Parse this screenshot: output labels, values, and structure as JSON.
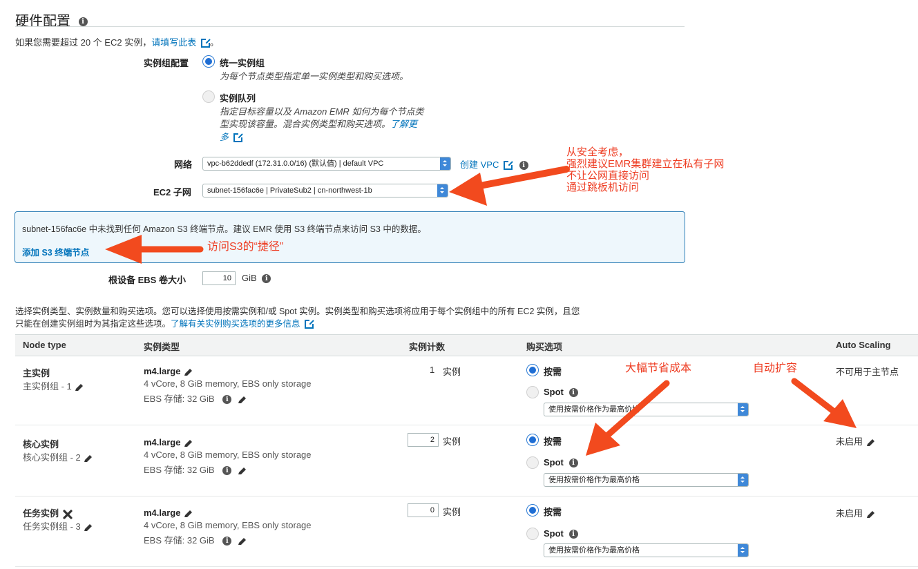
{
  "header": {
    "title": "硬件配置",
    "limit_text": "如果您需要超过 20 个 EC2 实例，",
    "limit_link": "请填写此表",
    "limit_suffix": "。"
  },
  "instance_group_config": {
    "label": "实例组配置",
    "options": [
      {
        "title": "统一实例组",
        "desc": "为每个节点类型指定单一实例类型和购买选项。",
        "selected": true
      },
      {
        "title": "实例队列",
        "desc_lines": [
          "指定目标容量以及 Amazon EMR 如何为每个节点类",
          "型实现该容量。混合实例类型和购买选项。"
        ],
        "learn_more": "了解更",
        "learn_more_2": "多",
        "selected": false
      }
    ]
  },
  "network": {
    "label": "网络",
    "value": "vpc-b62ddedf (172.31.0.0/16) (默认值) | default VPC",
    "create_link": "创建 VPC"
  },
  "subnet": {
    "label": "EC2 子网",
    "value": "subnet-156fac6e | PrivateSub2 | cn-northwest-1b"
  },
  "notice": {
    "text": "subnet-156fac6e 中未找到任何 Amazon S3 终端节点。建议 EMR 使用 S3 终端节点来访问 S3 中的数据。",
    "link": "添加 S3 终端节点"
  },
  "root_ebs": {
    "label": "根设备 EBS 卷大小",
    "value": "10",
    "unit": "GiB"
  },
  "description": {
    "line1": "选择实例类型、实例数量和购买选项。您可以选择使用按需实例和/或 Spot 实例。实例类型和购买选项将应用于每个实例组中的所有 EC2 实例，且您",
    "line2": "只能在创建实例组时为其指定这些选项。",
    "link": "了解有关实例购买选项的更多信息"
  },
  "table": {
    "headers": [
      "Node type",
      "实例类型",
      "实例计数",
      "购买选项",
      "Auto Scaling"
    ],
    "rows": [
      {
        "node": "主实例",
        "group": "主实例组 - 1",
        "type": "m4.large",
        "specs": "4 vCore, 8 GiB memory, EBS only storage",
        "ebs": "EBS 存储:  32 GiB",
        "count": "1",
        "count_unit": "实例",
        "count_editable": false,
        "on_demand": "按需",
        "spot": "Spot",
        "price": "使用按需价格作为最高价格",
        "autoscaling": "不可用于主节点",
        "removable": false
      },
      {
        "node": "核心实例",
        "group": "核心实例组 - 2",
        "type": "m4.large",
        "specs": "4 vCore, 8 GiB memory, EBS only storage",
        "ebs": "EBS 存储:  32 GiB",
        "count": "2",
        "count_unit": "实例",
        "count_editable": true,
        "on_demand": "按需",
        "spot": "Spot",
        "price": "使用按需价格作为最高价格",
        "autoscaling": "未启用",
        "removable": false
      },
      {
        "node": "任务实例",
        "group": "任务实例组 - 3",
        "type": "m4.large",
        "specs": "4 vCore, 8 GiB memory, EBS only storage",
        "ebs": "EBS 存储:  32 GiB",
        "count": "0",
        "count_unit": "实例",
        "count_editable": true,
        "on_demand": "按需",
        "spot": "Spot",
        "price": "使用按需价格作为最高价格",
        "autoscaling": "未启用",
        "removable": true
      }
    ]
  },
  "annotations": {
    "security": [
      "从安全考虑，",
      "强烈建议EMR集群建立在私有子网",
      "不让公网直接访问",
      "通过跳板机访问"
    ],
    "s3_shortcut": "访问S3的“捷径”",
    "save_cost": "大幅节省成本",
    "auto_scale": "自动扩容",
    "color": "#ee3d23"
  }
}
